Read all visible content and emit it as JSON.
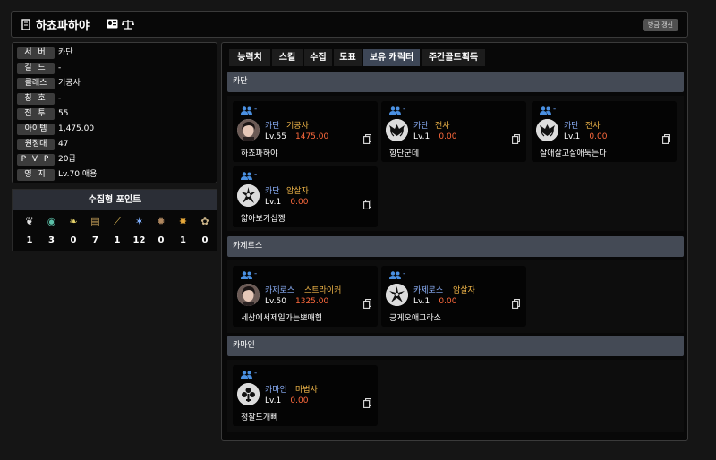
{
  "header": {
    "character_name": "하쵸파하야",
    "refresh_label": "방금 갱신"
  },
  "info": [
    {
      "label": "서 버",
      "value": "카단"
    },
    {
      "label": "길 드",
      "value": "-"
    },
    {
      "label": "클래스",
      "value": "기공사"
    },
    {
      "label": "칭 호",
      "value": "-"
    },
    {
      "label": "전 투",
      "value": "55"
    },
    {
      "label": "아이템",
      "value": "1,475.00"
    },
    {
      "label": "원정대",
      "value": "47"
    },
    {
      "label": "P V P",
      "value": "20급"
    },
    {
      "label": "영 지",
      "value": "Lv.70 애용"
    }
  ],
  "collect": {
    "title": "수집형 포인트",
    "icons": [
      "mokoko-seed-icon",
      "island-heart-icon",
      "giant-heart-icon",
      "great-art-icon",
      "ignea-token-icon",
      "omnium-star-icon",
      "adventure-icon",
      "orpheus-star-icon",
      "world-tree-leaf-icon"
    ],
    "values": [
      "1",
      "3",
      "0",
      "7",
      "1",
      "12",
      "0",
      "1",
      "0"
    ]
  },
  "tabs": [
    {
      "label": "능력치",
      "active": false
    },
    {
      "label": "스킬",
      "active": false
    },
    {
      "label": "수집",
      "active": false
    },
    {
      "label": "도표",
      "active": false
    },
    {
      "label": "보유 캐릭터",
      "active": true
    },
    {
      "label": "주간골드획득",
      "active": false
    }
  ],
  "sections": [
    {
      "server": "카단",
      "characters": [
        {
          "guild": "-",
          "server": "카단",
          "class": "기공사",
          "level": "Lv.55",
          "item_level": "1475.00",
          "name": "하쵸파하야",
          "avatar": "portrait-icon"
        },
        {
          "guild": "-",
          "server": "카단",
          "class": "전사",
          "level": "Lv.1",
          "item_level": "0.00",
          "name": "향단군데",
          "avatar": "warrior-emblem-icon"
        },
        {
          "guild": "-",
          "server": "카단",
          "class": "전사",
          "level": "Lv.1",
          "item_level": "0.00",
          "name": "살애살고살애둑는다",
          "avatar": "warrior-emblem-icon"
        },
        {
          "guild": "-",
          "server": "카단",
          "class": "암살자",
          "level": "Lv.1",
          "item_level": "0.00",
          "name": "얇아보기십껭",
          "avatar": "assassin-emblem-icon"
        }
      ]
    },
    {
      "server": "카제로스",
      "characters": [
        {
          "guild": "-",
          "server": "카제로스",
          "class": "스트라이커",
          "level": "Lv.50",
          "item_level": "1325.00",
          "name": "세상에서제일가는뽀때협",
          "avatar": "portrait-icon"
        },
        {
          "guild": "-",
          "server": "카제로스",
          "class": "암살자",
          "level": "Lv.1",
          "item_level": "0.00",
          "name": "긍게오애그라소",
          "avatar": "assassin-emblem-icon"
        }
      ]
    },
    {
      "server": "카마인",
      "characters": [
        {
          "guild": "-",
          "server": "카마인",
          "class": "마법사",
          "level": "Lv.1",
          "item_level": "0.00",
          "name": "정찰드개삐",
          "avatar": "mage-emblem-icon"
        }
      ]
    }
  ],
  "colors": {
    "accent_blue": "#6fa8ff",
    "server_blue": "#8fb4ff",
    "class_gold": "#f3b84a",
    "item_level_orange": "#ff6a3d",
    "active_tab": "#3d4656"
  }
}
